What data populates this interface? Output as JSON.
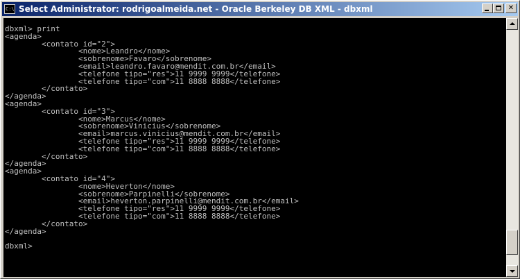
{
  "window": {
    "title": "Select Administrator:  rodrigoalmeida.net - Oracle Berkeley DB XML - dbxml",
    "app_icon_label": "C:\\.",
    "buttons": {
      "minimize_icon": "minimize-icon",
      "maximize_icon": "maximize-icon",
      "close_icon": "close-icon",
      "close_glyph": "✕"
    },
    "titlebar_color": "#0a246a"
  },
  "console": {
    "background": "#000000",
    "foreground": "#c0c0c0",
    "lines": [
      "dbxml> print",
      "<agenda>",
      "        <contato id=\"2\">",
      "                <nome>Leandro</nome>",
      "                <sobrenome>Favaro</sobrenome>",
      "                <email>leandro.favaro@mendit.com.br</email>",
      "                <telefone tipo=\"res\">11 9999 9999</telefone>",
      "                <telefone tipo=\"com\">11 8888 8888</telefone>",
      "        </contato>",
      "</agenda>",
      "<agenda>",
      "        <contato id=\"3\">",
      "                <nome>Marcus</nome>",
      "                <sobrenome>Vinicius</sobrenome>",
      "                <email>marcus.vinicius@mendit.com.br</email>",
      "                <telefone tipo=\"res\">11 9999 9999</telefone>",
      "                <telefone tipo=\"com\">11 8888 8888</telefone>",
      "        </contato>",
      "</agenda>",
      "<agenda>",
      "        <contato id=\"4\">",
      "                <nome>Heverton</nome>",
      "                <sobrenome>Parpinelli</sobrenome>",
      "                <email>heverton.parpinelli@mendit.com.br</email>",
      "                <telefone tipo=\"res\">11 9999 9999</telefone>",
      "                <telefone tipo=\"com\">11 8888 8888</telefone>",
      "        </contato>",
      "</agenda>",
      "",
      "dbxml>"
    ]
  },
  "scrollbar": {
    "position_fraction": 0.95
  }
}
